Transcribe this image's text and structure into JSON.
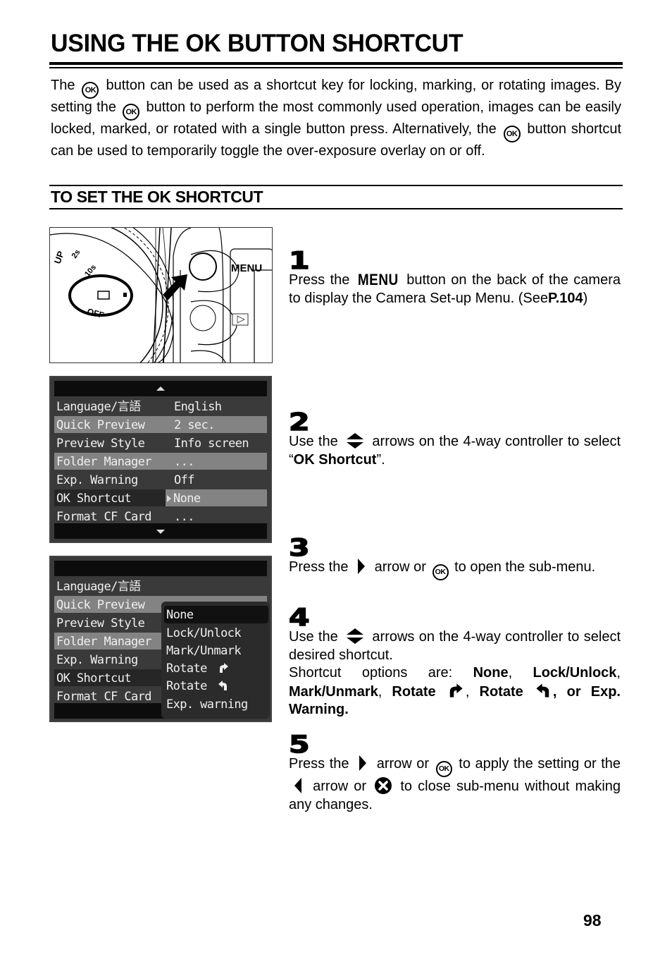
{
  "page": {
    "title": "USING THE OK BUTTON SHORTCUT",
    "page_number": "98"
  },
  "intro": {
    "p1": "The",
    "p2": "button can be used as a shortcut key for locking, marking, or rotating images.  By setting the",
    "p3": "button to perform the most commonly used operation, images can be easily locked, marked, or rotated with a single button press. Alternatively, the",
    "p4": "button shortcut can be used to temporarily toggle the over-exposure overlay on or off."
  },
  "icons": {
    "ok": "OK",
    "menu": "MENU",
    "playback": "▷"
  },
  "section": {
    "title": "TO SET THE OK SHORTCUT"
  },
  "camera_figure": {
    "menu_label": "MENU",
    "dial_labels": [
      "UP",
      "2s",
      "10s",
      "OFF"
    ]
  },
  "screen1": {
    "rows": [
      {
        "label": "Language/言語",
        "value": "English",
        "highlight": false
      },
      {
        "label": "Quick Preview",
        "value": "2 sec.",
        "highlight": true
      },
      {
        "label": "Preview Style",
        "value": "Info screen",
        "highlight": false
      },
      {
        "label": "Folder Manager",
        "value": "...",
        "highlight": true
      },
      {
        "label": "Exp. Warning",
        "value": "Off",
        "highlight": false
      },
      {
        "label": "OK Shortcut",
        "value": "None",
        "highlight": false,
        "selected": true
      },
      {
        "label": "Format CF Card",
        "value": "...",
        "highlight": false
      }
    ]
  },
  "screen2": {
    "rows": [
      {
        "label": "Language/言語"
      },
      {
        "label": "Quick Preview"
      },
      {
        "label": "Preview Style"
      },
      {
        "label": "Folder Manager"
      },
      {
        "label": "Exp. Warning"
      },
      {
        "label": "OK Shortcut"
      },
      {
        "label": "Format CF Card"
      }
    ],
    "submenu": [
      {
        "label": "None",
        "selected": true
      },
      {
        "label": "Lock/Unlock"
      },
      {
        "label": "Mark/Unmark"
      },
      {
        "label": "Rotate",
        "icon": "rotate-clockwise-icon"
      },
      {
        "label": "Rotate",
        "icon": "rotate-counterclockwise-icon"
      },
      {
        "label": "Exp. warning"
      }
    ]
  },
  "steps": [
    {
      "number": "1",
      "t1": "Press the",
      "t2": "button on the back of the camera to display the Camera Set-up Menu. (See",
      "ref": "P.104",
      "t3": ")"
    },
    {
      "number": "2",
      "t1": "Use the",
      "t2": "arrows on the 4-way controller to select “",
      "bold": "OK Shortcut",
      "t3": "”."
    },
    {
      "number": "3",
      "t1": "Press the",
      "t2": "arrow or",
      "t3": "to open the sub-menu."
    },
    {
      "number": "4",
      "t1": "Use the",
      "t2": "arrows on the 4-way controller to select desired shortcut.",
      "t3": "Shortcut options are:",
      "opt1": "None",
      "opt2": "Lock/Unlock",
      "opt3": "Mark/Unmark",
      "opt4": "Rotate",
      "opt5": "Rotate",
      "opt6": ", or Exp. Warning."
    },
    {
      "number": "5",
      "t1": "Press the",
      "t2": "arrow or",
      "t3": "to apply the setting or the",
      "t4": "arrow or",
      "t5": "to close sub-menu without making any changes."
    }
  ]
}
